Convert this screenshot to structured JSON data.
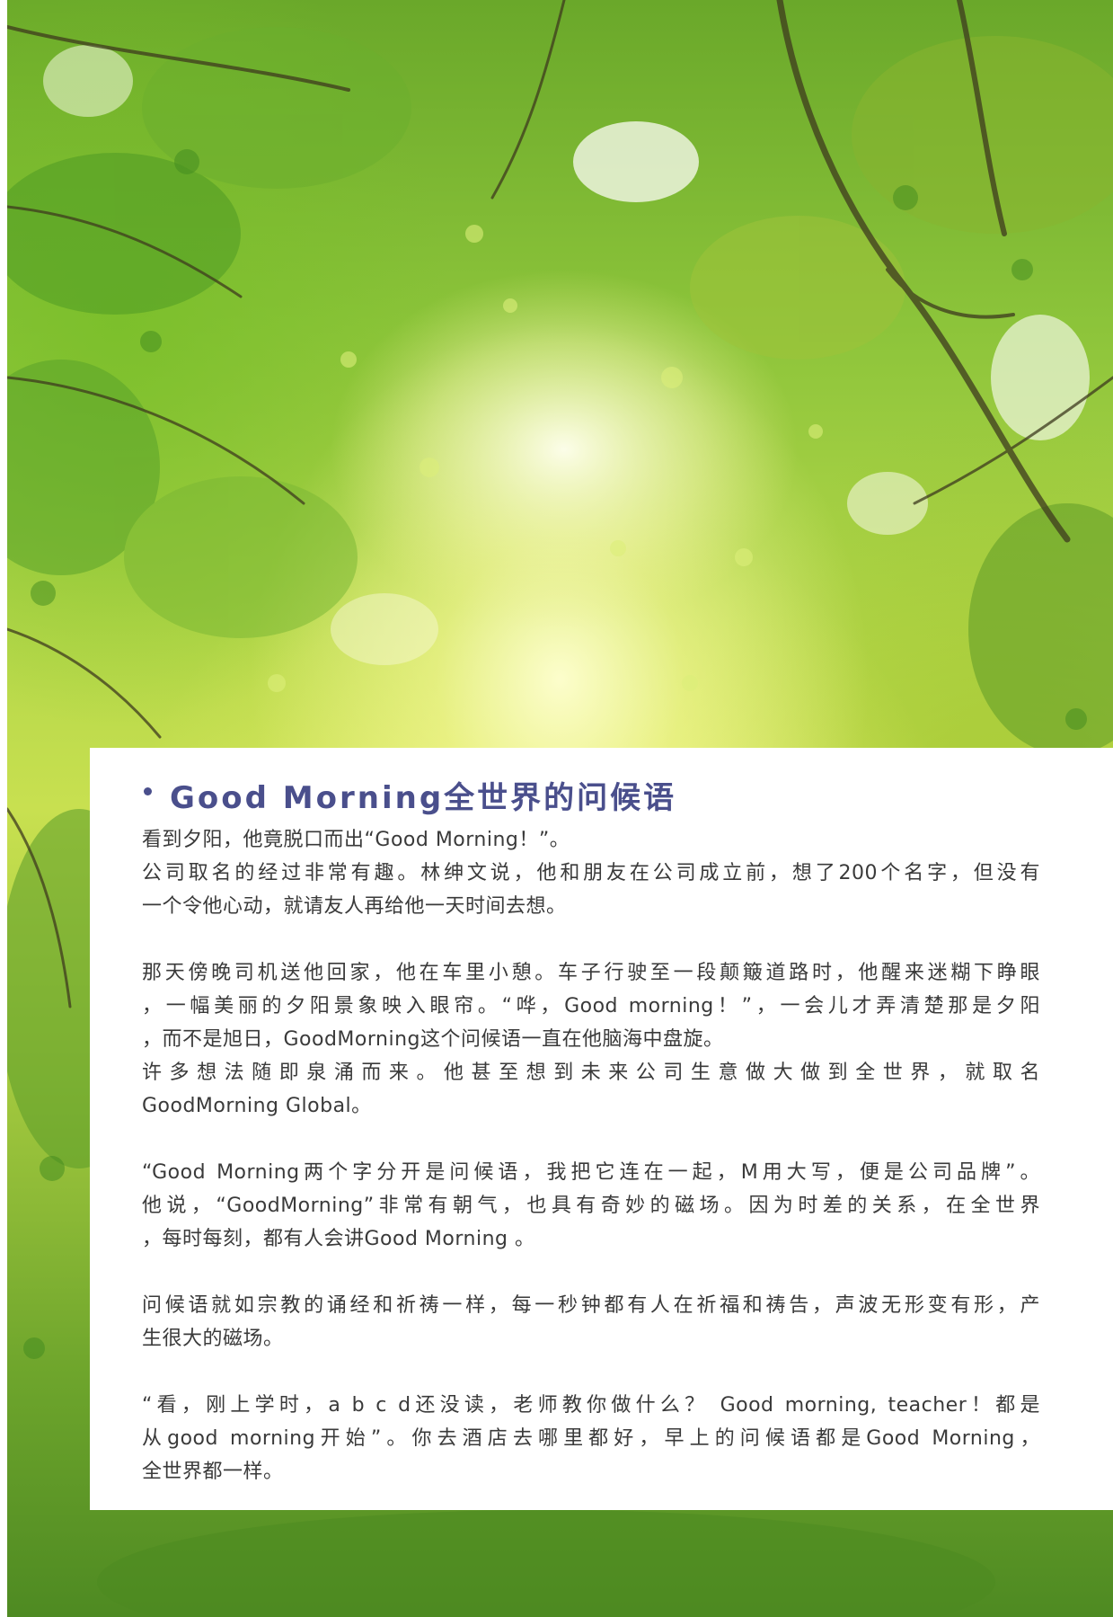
{
  "heading": "Good Morning全世界的问候语",
  "paragraphs": [
    {
      "lines": [
        "看到夕阳，他竟脱口而出“Good Morning！”。",
        "公司取名的经过非常有趣。林绅文说，他和朋友在公司成立前，想了200个名字，但没有",
        "一个令他心动，就请友人再给他一天时间去想。"
      ]
    },
    {
      "lines": [
        "那天傍晚司机送他回家，他在车里小憩。车子行驶至一段颠簸道路时，他醒来迷糊下睁眼",
        "，一幅美丽的夕阳景象映入眼帘。“哗，Good morning！”，一会儿才弄清楚那是夕阳",
        "，而不是旭日，GoodMorning这个问候语一直在他脑海中盘旋。",
        "许多想法随即泉涌而来。他甚至想到未来公司生意做大做到全世界，就取名",
        "GoodMorning Global。"
      ]
    },
    {
      "lines": [
        "“Good Morning两个字分开是问候语，我把它连在一起，M用大写，便是公司品牌”。",
        "他说，“GoodMorning”非常有朝气，也具有奇妙的磁场。因为时差的关系，在全世界",
        "，每时每刻，都有人会讲Good Morning 。"
      ]
    },
    {
      "lines": [
        "问候语就如宗教的诵经和祈祷一样，每一秒钟都有人在祈福和祷告，声波无形变有形，产",
        "生很大的磁场。"
      ]
    },
    {
      "lines": [
        "“看，刚上学时，a b c d还没读，老师教你做什么？ Good morning, teacher！都是",
        "从good morning开始”。你去酒店去哪里都好，早上的问候语都是Good Morning，",
        "全世界都一样。"
      ]
    }
  ],
  "colors": {
    "heading": "#4a4f8c",
    "body_text": "#3a3a3a",
    "card_background": "#ffffff"
  }
}
